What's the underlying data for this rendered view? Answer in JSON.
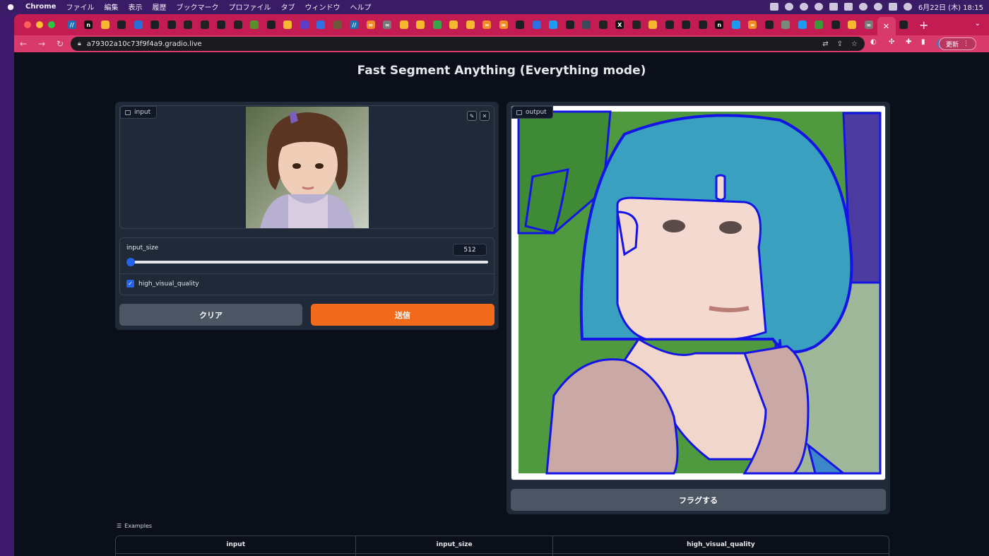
{
  "menubar": {
    "app_name": "Chrome",
    "menus": [
      "ファイル",
      "編集",
      "表示",
      "履歴",
      "ブックマーク",
      "プロファイル",
      "タブ",
      "ウィンドウ",
      "ヘルプ"
    ],
    "clock": "6月22日 (木)  18:15"
  },
  "browser": {
    "url": "a79302a10c73f9f4a9.gradio.live",
    "update_label": "更新",
    "tab_favicons": [
      {
        "icon": "perplexity-icon",
        "color": "#1f6fb5",
        "glyph": "//"
      },
      {
        "icon": "notion-icon",
        "color": "#111111",
        "glyph": "n"
      },
      {
        "icon": "huggingface-icon",
        "color": "#f5b82e",
        "glyph": ""
      },
      {
        "icon": "github-icon",
        "color": "#1b1f23",
        "glyph": ""
      },
      {
        "icon": "flag-icon",
        "color": "#2a6fd6",
        "glyph": ""
      },
      {
        "icon": "github-icon",
        "color": "#1b1f23",
        "glyph": ""
      },
      {
        "icon": "github-icon",
        "color": "#1b1f23",
        "glyph": ""
      },
      {
        "icon": "globe-icon",
        "color": "#222222",
        "glyph": ""
      },
      {
        "icon": "globe-icon",
        "color": "#222222",
        "glyph": ""
      },
      {
        "icon": "github-icon",
        "color": "#1b1f23",
        "glyph": ""
      },
      {
        "icon": "globe-icon",
        "color": "#222222",
        "glyph": ""
      },
      {
        "icon": "plant-icon",
        "color": "#5a8f2e",
        "glyph": ""
      },
      {
        "icon": "github-icon",
        "color": "#1b1f23",
        "glyph": ""
      },
      {
        "icon": "huggingface-icon",
        "color": "#f5b82e",
        "glyph": ""
      },
      {
        "icon": "circle-icon",
        "color": "#5b3fc9",
        "glyph": ""
      },
      {
        "icon": "docs-icon",
        "color": "#2f6fe0",
        "glyph": ""
      },
      {
        "icon": "image-icon",
        "color": "#6b5a3a",
        "glyph": ""
      },
      {
        "icon": "perplexity-icon",
        "color": "#1f6fb5",
        "glyph": "//"
      },
      {
        "icon": "infinity-icon",
        "color": "#f28c28",
        "glyph": "∞"
      },
      {
        "icon": "infinity-icon",
        "color": "#7a7a7a",
        "glyph": "∞"
      },
      {
        "icon": "huggingface-icon",
        "color": "#f5b82e",
        "glyph": ""
      },
      {
        "icon": "huggingface-icon",
        "color": "#f5b82e",
        "glyph": ""
      },
      {
        "icon": "leaf-icon",
        "color": "#3aa64a",
        "glyph": ""
      },
      {
        "icon": "huggingface-icon",
        "color": "#f5b82e",
        "glyph": ""
      },
      {
        "icon": "huggingface-icon",
        "color": "#f5b82e",
        "glyph": ""
      },
      {
        "icon": "infinity-icon",
        "color": "#f28c28",
        "glyph": "∞"
      },
      {
        "icon": "infinity-icon",
        "color": "#f28c28",
        "glyph": "∞"
      },
      {
        "icon": "github-icon",
        "color": "#1b1f23",
        "glyph": ""
      },
      {
        "icon": "docs-icon",
        "color": "#2f6fe0",
        "glyph": ""
      },
      {
        "icon": "twitter-icon",
        "color": "#1d9bf0",
        "glyph": ""
      },
      {
        "icon": "github-icon",
        "color": "#1b1f23",
        "glyph": ""
      },
      {
        "icon": "book-icon",
        "color": "#3a4a5a",
        "glyph": ""
      },
      {
        "icon": "globe-icon",
        "color": "#222222",
        "glyph": ""
      },
      {
        "icon": "x-icon",
        "color": "#111111",
        "glyph": "X"
      },
      {
        "icon": "globe-icon",
        "color": "#222222",
        "glyph": ""
      },
      {
        "icon": "huggingface-icon",
        "color": "#f5b82e",
        "glyph": ""
      },
      {
        "icon": "github-icon",
        "color": "#1b1f23",
        "glyph": ""
      },
      {
        "icon": "github-icon",
        "color": "#1b1f23",
        "glyph": ""
      },
      {
        "icon": "github-icon",
        "color": "#1b1f23",
        "glyph": ""
      },
      {
        "icon": "notion-icon",
        "color": "#111111",
        "glyph": "n"
      },
      {
        "icon": "twitter-icon",
        "color": "#1d9bf0",
        "glyph": ""
      },
      {
        "icon": "infinity-icon",
        "color": "#f28c28",
        "glyph": "∞"
      },
      {
        "icon": "github-icon",
        "color": "#1b1f23",
        "glyph": ""
      },
      {
        "icon": "image-icon",
        "color": "#7a8a7a",
        "glyph": ""
      },
      {
        "icon": "twitter-icon",
        "color": "#1d9bf0",
        "glyph": ""
      },
      {
        "icon": "plant-icon",
        "color": "#3a9a3a",
        "glyph": ""
      },
      {
        "icon": "github-icon",
        "color": "#1b1f23",
        "glyph": ""
      },
      {
        "icon": "huggingface-icon",
        "color": "#f5b82e",
        "glyph": ""
      },
      {
        "icon": "infinity-icon",
        "color": "#7a7a7a",
        "glyph": "∞"
      }
    ]
  },
  "app": {
    "title": "Fast Segment Anything (Everything mode)",
    "input_label": "input",
    "output_label": "output",
    "slider": {
      "label": "input_size",
      "value": "512",
      "fraction": 0.0
    },
    "checkbox": {
      "label": "high_visual_quality",
      "checked": true
    },
    "clear_label": "クリア",
    "submit_label": "送信",
    "flag_label": "フラグする",
    "examples": {
      "label": "Examples",
      "columns": [
        "input",
        "input_size",
        "high_visual_quality"
      ]
    },
    "colors": {
      "accent": "#f26a1b",
      "checkbox": "#2563eb",
      "mask_outline": "#1414e6"
    }
  }
}
